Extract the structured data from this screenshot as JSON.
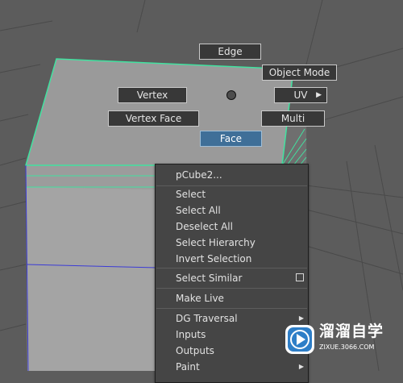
{
  "colors": {
    "viewport_bg": "#5c5c5c",
    "active_accent": "#3f6f98",
    "selection_highlight": "#41e2a0"
  },
  "marking_menu": {
    "edge": "Edge",
    "object_mode": "Object Mode",
    "vertex": "Vertex",
    "uv": "UV",
    "vertex_face": "Vertex Face",
    "multi": "Multi",
    "face": "Face"
  },
  "context_menu": {
    "title": "pCube2...",
    "items": [
      {
        "label": "Select"
      },
      {
        "label": "Select All"
      },
      {
        "label": "Deselect All"
      },
      {
        "label": "Select Hierarchy"
      },
      {
        "label": "Invert Selection"
      },
      {
        "label": "Select Similar",
        "option_box": true
      },
      {
        "label": "Make Live"
      },
      {
        "label": "DG Traversal",
        "submenu": true
      },
      {
        "label": "Inputs"
      },
      {
        "label": "Outputs"
      },
      {
        "label": "Paint",
        "submenu": true
      }
    ]
  },
  "watermark": {
    "title": "溜溜自学",
    "url": "ZIXUE.3066.COM",
    "icon": "play-icon"
  }
}
